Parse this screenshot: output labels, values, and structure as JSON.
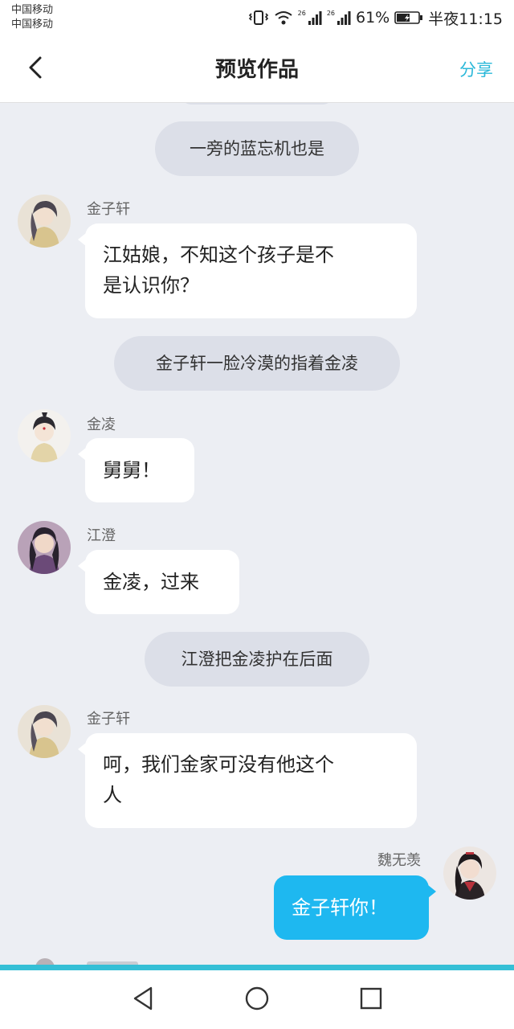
{
  "status_bar": {
    "carrier_1": "中国移动",
    "carrier_2": "中国移动",
    "net_1": "26",
    "net_2": "26",
    "battery_percent": "61%",
    "time": "半夜11:15"
  },
  "header": {
    "title": "预览作品",
    "share_label": "分享"
  },
  "messages": [
    {
      "type": "narration",
      "text": "一旁的蓝忘机也是"
    },
    {
      "type": "message",
      "side": "left",
      "speaker": "金子轩",
      "line1": "江姑娘，不知这个孩子是不",
      "line2": "是认识你？"
    },
    {
      "type": "narration",
      "text": "金子轩一脸冷漠的指着金凌"
    },
    {
      "type": "message",
      "side": "left",
      "speaker": "金凌",
      "text": "舅舅！"
    },
    {
      "type": "message",
      "side": "left",
      "speaker": "江澄",
      "text": "金凌，过来"
    },
    {
      "type": "narration",
      "text": "江澄把金凌护在后面"
    },
    {
      "type": "message",
      "side": "left",
      "speaker": "金子轩",
      "line1": "呵，我们金家可没有他这个",
      "line2": "人"
    },
    {
      "type": "message",
      "side": "right",
      "speaker": "魏无羡",
      "text": "金子轩你！"
    }
  ],
  "colors": {
    "accent": "#2bb8d9",
    "chat_background": "#eceef3",
    "narration_bubble": "#dcdfe8",
    "own_bubble": "#1eb8f0"
  },
  "icons": {
    "back": "chevron-left-icon",
    "nav_back": "triangle-back-icon",
    "nav_home": "circle-home-icon",
    "nav_recent": "square-recent-icon"
  }
}
